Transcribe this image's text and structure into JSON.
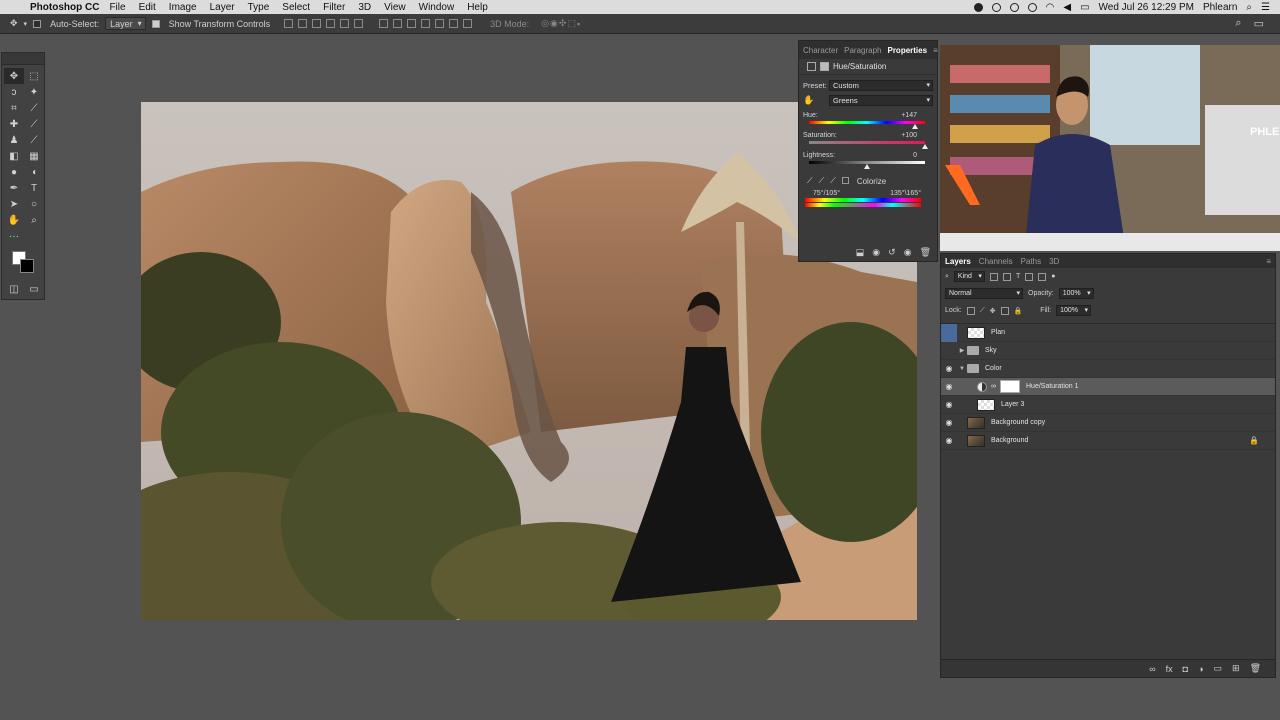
{
  "menubar": {
    "app_name": "Photoshop CC",
    "menus": [
      "File",
      "Edit",
      "Image",
      "Layer",
      "Type",
      "Select",
      "Filter",
      "3D",
      "View",
      "Window",
      "Help"
    ],
    "datetime": "Wed Jul 26  12:29 PM",
    "user": "Phlearn"
  },
  "options": {
    "auto_select_label": "Auto-Select:",
    "auto_select_value": "Layer",
    "show_transform_label": "Show Transform Controls",
    "mode_3d_label": "3D Mode:"
  },
  "properties": {
    "tabs": [
      "Character",
      "Paragraph",
      "Properties"
    ],
    "adjustment_title": "Hue/Saturation",
    "preset_label": "Preset:",
    "preset_value": "Custom",
    "channel_value": "Greens",
    "hue_label": "Hue:",
    "hue_value": "+147",
    "hue_fraction": 0.91,
    "saturation_label": "Saturation:",
    "saturation_value": "+100",
    "saturation_fraction": 1.0,
    "lightness_label": "Lightness:",
    "lightness_value": "0",
    "lightness_fraction": 0.5,
    "colorize_label": "Colorize",
    "range_left": "75°/105°",
    "range_right": "135°\\165°"
  },
  "layers_panel": {
    "tabs": [
      "Layers",
      "Channels",
      "Paths",
      "3D"
    ],
    "filter_kind": "Kind",
    "blend_mode": "Normal",
    "opacity_label": "Opacity:",
    "opacity_value": "100%",
    "lock_label": "Lock:",
    "fill_label": "Fill:",
    "fill_value": "100%",
    "layers": [
      {
        "name": "Plan"
      },
      {
        "name": "Sky"
      },
      {
        "name": "Color"
      },
      {
        "name": "Hue/Saturation 1"
      },
      {
        "name": "Layer 3"
      },
      {
        "name": "Background copy"
      },
      {
        "name": "Background"
      }
    ]
  },
  "video": {
    "sign_text": "PHLEA"
  }
}
